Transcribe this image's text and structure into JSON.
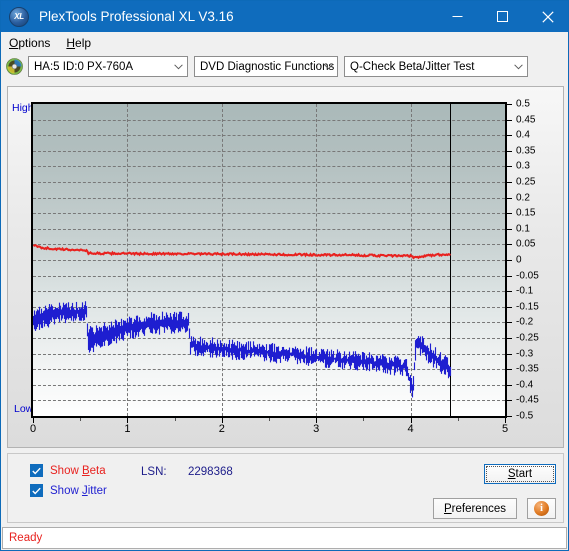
{
  "window": {
    "title": "PlexTools Professional XL V3.16",
    "icon": "XL",
    "minimize": "minimize-icon",
    "maximize": "maximize-icon",
    "close": "close-icon"
  },
  "menu": {
    "items": [
      {
        "label": "Options",
        "mnemonic": "O"
      },
      {
        "label": "Help",
        "mnemonic": "H"
      }
    ]
  },
  "toolbar": {
    "disc_icon": "disc-icon",
    "drive_select": "HA:5 ID:0  PX-760A",
    "function_select": "DVD Diagnostic Functions",
    "test_select": "Q-Check Beta/Jitter Test"
  },
  "chart": {
    "axis_high_label": "High",
    "axis_low_label": "Low"
  },
  "controls": {
    "show_beta_label": "Show Beta",
    "show_beta_mnemonic": "B",
    "show_beta_checked": true,
    "show_jitter_label": "Show Jitter",
    "show_jitter_mnemonic": "J",
    "show_jitter_checked": true,
    "lsn_label": "LSN:",
    "lsn_value": "2298368",
    "start_label": "Start",
    "start_mnemonic": "S",
    "preferences_label": "Preferences",
    "preferences_mnemonic": "P",
    "info_label": "i"
  },
  "status": {
    "text": "Ready"
  },
  "colors": {
    "titlebar": "#0f6cbd",
    "beta": "#e8221f",
    "jitter": "#1f1fd0",
    "accent": "#0f6cbd",
    "status": "#e8221f",
    "grid": "#787878"
  },
  "chart_data": {
    "type": "line",
    "title": "Q-Check Beta/Jitter Test",
    "xlabel": "",
    "ylabel": "",
    "xlim": [
      0,
      5
    ],
    "ylim": [
      -0.5,
      0.5
    ],
    "xticks": [
      0,
      1,
      2,
      3,
      4,
      5
    ],
    "xticklabels": [
      "0",
      "1",
      "2",
      "3",
      "4",
      "5"
    ],
    "yticks": [
      0.5,
      0.45,
      0.4,
      0.35,
      0.3,
      0.25,
      0.2,
      0.15,
      0.1,
      0.05,
      0,
      -0.05,
      -0.1,
      -0.15,
      -0.2,
      -0.25,
      -0.3,
      -0.35,
      -0.4,
      -0.45,
      -0.5
    ],
    "yticklabels": [
      "0.5",
      "0.45",
      "0.4",
      "0.35",
      "0.3",
      "0.25",
      "0.2",
      "0.15",
      "0.1",
      "0.05",
      "0",
      "-0.05",
      "-0.1",
      "-0.15",
      "-0.2",
      "-0.25",
      "-0.3",
      "-0.35",
      "-0.4",
      "-0.45",
      "-0.5"
    ],
    "grid": true,
    "legend": [
      "Show Beta",
      "Show Jitter"
    ],
    "data_end_x": 4.42,
    "series": [
      {
        "name": "Beta",
        "color": "#e8221f",
        "x": [
          0.0,
          0.05,
          0.1,
          0.2,
          0.3,
          0.4,
          0.5,
          0.56,
          0.58,
          0.7,
          0.9,
          1.1,
          1.3,
          1.5,
          1.66,
          1.7,
          1.9,
          2.1,
          2.3,
          2.5,
          2.7,
          2.9,
          3.1,
          3.3,
          3.5,
          3.7,
          3.9,
          4.0,
          4.02,
          4.1,
          4.2,
          4.3,
          4.42
        ],
        "y": [
          0.047,
          0.042,
          0.039,
          0.036,
          0.034,
          0.033,
          0.032,
          0.031,
          0.022,
          0.021,
          0.021,
          0.02,
          0.02,
          0.02,
          0.02,
          0.019,
          0.019,
          0.019,
          0.018,
          0.018,
          0.017,
          0.017,
          0.016,
          0.016,
          0.015,
          0.014,
          0.013,
          0.013,
          0.009,
          0.01,
          0.015,
          0.017,
          0.017
        ]
      },
      {
        "name": "Jitter",
        "color": "#1f1fd0",
        "band": true,
        "x": [
          0.0,
          0.1,
          0.2,
          0.3,
          0.4,
          0.5,
          0.56,
          0.58,
          0.65,
          0.75,
          0.85,
          0.95,
          1.05,
          1.15,
          1.25,
          1.35,
          1.45,
          1.55,
          1.64,
          1.66,
          1.75,
          1.9,
          2.05,
          2.2,
          2.4,
          2.6,
          2.8,
          3.0,
          3.2,
          3.4,
          3.6,
          3.8,
          3.95,
          4.02,
          4.05,
          4.08,
          4.12,
          4.2,
          4.3,
          4.42
        ],
        "y_upper": [
          -0.165,
          -0.16,
          -0.152,
          -0.148,
          -0.147,
          -0.146,
          -0.146,
          -0.228,
          -0.224,
          -0.215,
          -0.205,
          -0.196,
          -0.19,
          -0.186,
          -0.182,
          -0.18,
          -0.179,
          -0.178,
          -0.177,
          -0.25,
          -0.258,
          -0.262,
          -0.268,
          -0.272,
          -0.276,
          -0.282,
          -0.288,
          -0.294,
          -0.3,
          -0.306,
          -0.312,
          -0.318,
          -0.324,
          -0.4,
          -0.25,
          -0.252,
          -0.258,
          -0.28,
          -0.305,
          -0.33
        ],
        "y_lower": [
          -0.215,
          -0.208,
          -0.198,
          -0.19,
          -0.186,
          -0.184,
          -0.184,
          -0.29,
          -0.282,
          -0.268,
          -0.256,
          -0.246,
          -0.238,
          -0.232,
          -0.228,
          -0.225,
          -0.222,
          -0.22,
          -0.218,
          -0.292,
          -0.296,
          -0.3,
          -0.305,
          -0.308,
          -0.312,
          -0.317,
          -0.322,
          -0.328,
          -0.334,
          -0.34,
          -0.347,
          -0.354,
          -0.36,
          -0.448,
          -0.292,
          -0.294,
          -0.3,
          -0.322,
          -0.348,
          -0.375
        ]
      }
    ]
  }
}
